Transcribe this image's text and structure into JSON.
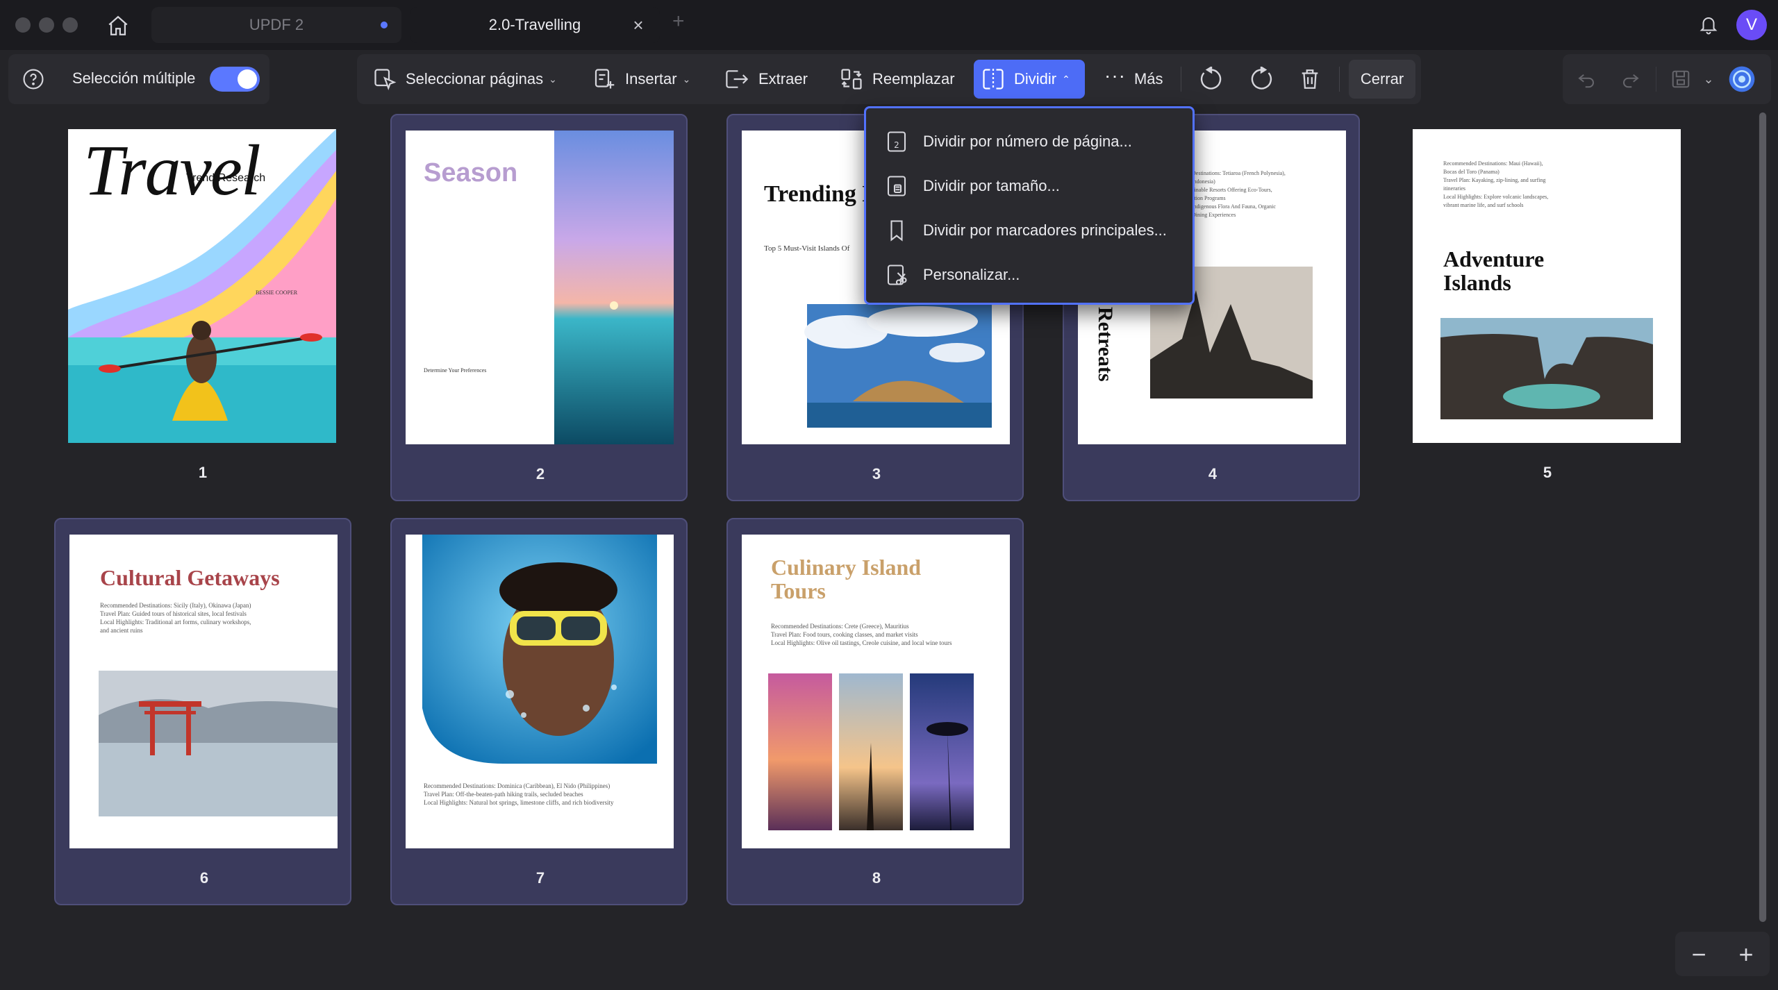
{
  "window": {
    "tabs": [
      {
        "label": "UPDF 2"
      },
      {
        "label": "2.0-Travelling"
      }
    ],
    "avatar_letter": "V"
  },
  "toolbar": {
    "multi_select_label": "Selección múltiple",
    "select_pages": "Seleccionar páginas",
    "insert": "Insertar",
    "extract": "Extraer",
    "replace": "Reemplazar",
    "split": "Dividir",
    "more": "Más",
    "close": "Cerrar"
  },
  "split_menu": {
    "items": [
      {
        "label": "Dividir por número de página...",
        "icon": "page-number-icon"
      },
      {
        "label": "Dividir por tamaño...",
        "icon": "file-size-icon"
      },
      {
        "label": "Dividir por marcadores principales...",
        "icon": "bookmark-icon"
      },
      {
        "label": "Personalizar...",
        "icon": "custom-scissors-icon"
      }
    ]
  },
  "pages": [
    {
      "number": "1",
      "title": "Travel",
      "subtitle": "Trend Research",
      "author": "BESSIE COOPER"
    },
    {
      "number": "2",
      "title": "Season",
      "heading": "Determine Your Preferences"
    },
    {
      "number": "3",
      "title": "Trending Destinatio",
      "subtitle": "Top 5 Must-Visit Islands Of"
    },
    {
      "number": "4",
      "title": "Retreats"
    },
    {
      "number": "5",
      "title": "Adventure Islands"
    },
    {
      "number": "6",
      "title": "Cultural Getaways"
    },
    {
      "number": "7",
      "title": ""
    },
    {
      "number": "8",
      "title": "Culinary Island Tours"
    }
  ],
  "page_text": {
    "p3_sub": "Top 5 Must-Visit Islands Of",
    "p4_lines": [
      "Destinations: Tetiaroa (French Polynesia),",
      "Indonesia)",
      "ainable Resorts Offering Eco-Tours,",
      "ation Programs",
      "Indigenous Flora And Fauna, Organic",
      "Dining Experiences"
    ],
    "p5_lines": [
      "Recommended Destinations: Maui (Hawaii),",
      "Bocas del Toro (Panama)",
      "Travel Plan: Kayaking, zip-lining, and surfing",
      "itineraries",
      "Local Highlights: Explore volcanic landscapes,",
      "vibrant marine life, and surf schools"
    ],
    "p6_lines": [
      "Recommended Destinations: Sicily (Italy), Okinawa (Japan)",
      "Travel Plan: Guided tours of historical sites, local festivals",
      "Local Highlights: Traditional art forms, culinary workshops,",
      "and ancient ruins"
    ],
    "p7_lines": [
      "Recommended Destinations: Dominica (Caribbean), El Nido (Philippines)",
      "Travel Plan: Off-the-beaten-path hiking trails, secluded beaches",
      "Local Highlights: Natural hot springs, limestone cliffs, and rich biodiversity"
    ],
    "p8_lines": [
      "Recommended Destinations: Crete (Greece), Mauritius",
      "Travel Plan: Food tours, cooking classes, and market visits",
      "Local Highlights: Olive oil tastings, Creole cuisine, and local wine tours"
    ]
  },
  "colors": {
    "accent": "#4d6cf6",
    "selected_card": "#3a3a5c",
    "background": "#242428"
  }
}
